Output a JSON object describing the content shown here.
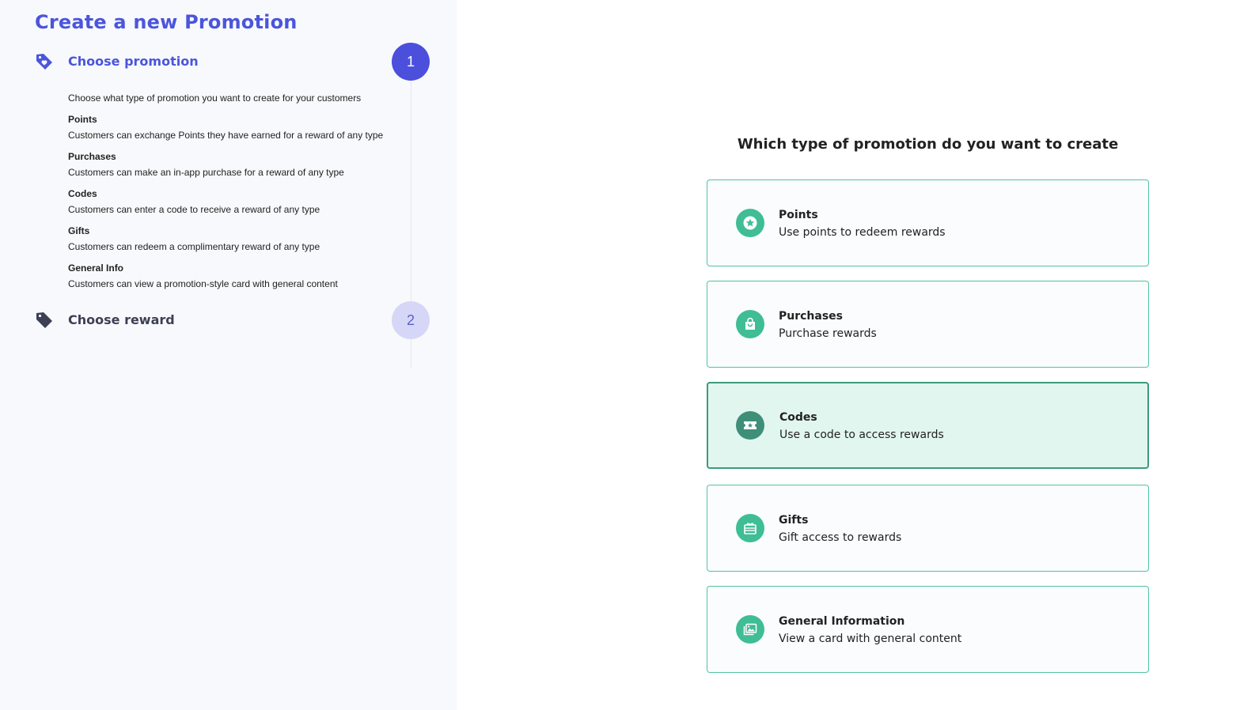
{
  "page": {
    "title": "Create a new Promotion"
  },
  "steps": [
    {
      "number": "1",
      "title": "Choose promotion",
      "icon": "tag-heart-icon",
      "state": "active"
    },
    {
      "number": "2",
      "title": "Choose reward",
      "icon": "tag-icon",
      "state": "inactive"
    }
  ],
  "step1_details": {
    "intro": "Choose what type of promotion you want to create for your customers",
    "options": [
      {
        "title": "Points",
        "text": "Customers can exchange Points they have earned for a reward of any type"
      },
      {
        "title": "Purchases",
        "text": "Customers can make an in-app purchase for a reward of any type"
      },
      {
        "title": "Codes",
        "text": "Customers can enter a code to receive a reward of any type"
      },
      {
        "title": "Gifts",
        "text": "Customers can redeem a complimentary reward of any type"
      },
      {
        "title": "General Info",
        "text": "Customers can view a promotion-style card with general content"
      }
    ]
  },
  "main": {
    "heading": "Which type of promotion do you want to create",
    "cards": [
      {
        "title": "Points",
        "subtitle": "Use points to redeem rewards",
        "icon": "star-coin-icon",
        "selected": false
      },
      {
        "title": "Purchases",
        "subtitle": "Purchase rewards",
        "icon": "shopping-bag-icon",
        "selected": false
      },
      {
        "title": "Codes",
        "subtitle": "Use a code to access rewards",
        "icon": "ticket-star-icon",
        "selected": true
      },
      {
        "title": "Gifts",
        "subtitle": "Gift access to rewards",
        "icon": "gift-card-icon",
        "selected": false
      },
      {
        "title": "General Information",
        "subtitle": "View a card with general content",
        "icon": "image-gallery-icon",
        "selected": false
      }
    ]
  },
  "colors": {
    "accent": "#4b55dc",
    "card_border": "#52c3a0",
    "card_icon_bg": "#3fbd94",
    "selected_bg": "#e2f6f0",
    "selected_border": "#3d9a7d"
  }
}
